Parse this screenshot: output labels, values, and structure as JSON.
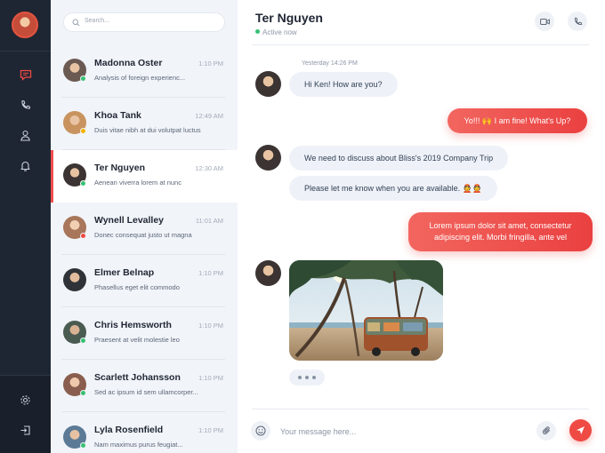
{
  "search": {
    "placeholder": "Search..."
  },
  "contacts": [
    {
      "name": "Madonna Oster",
      "time": "1:10 PM",
      "preview": "Analysis of foreign experienc...",
      "status": "online",
      "avatar_color": "#6b5a52"
    },
    {
      "name": "Khoa Tank",
      "time": "12:49 AM",
      "preview": "Duis vitae nibh at dui volutpat luctus",
      "status": "away",
      "avatar_color": "#c8935f"
    },
    {
      "name": "Ter  Nguyen",
      "time": "12:30 AM",
      "preview": "Aenean viverra lorem at nunc",
      "status": "online",
      "avatar_color": "#3b3432"
    },
    {
      "name": "Wynell Levalley",
      "time": "11:01 AM",
      "preview": "Donec consequat justo ut magna",
      "status": "busy",
      "avatar_color": "#a8765a"
    },
    {
      "name": "Elmer Belnap",
      "time": "1:10 PM",
      "preview": "Phasellus eget elit commodo",
      "status": "none",
      "avatar_color": "#2f3338"
    },
    {
      "name": "Chris Hemsworth",
      "time": "1:10 PM",
      "preview": "Praesent at velit molestie leo",
      "status": "online",
      "avatar_color": "#4a5b52"
    },
    {
      "name": "Scarlett Johansson",
      "time": "1:10 PM",
      "preview": "Sed ac ipsum id sem ullamcorper...",
      "status": "online",
      "avatar_color": "#8a5e4e"
    },
    {
      "name": "Lyla Rosenfield",
      "time": "1:10 PM",
      "preview": "Nam maximus purus feugiat...",
      "status": "online",
      "avatar_color": "#5c7a96"
    }
  ],
  "header": {
    "name": "Ter Nguyen",
    "status": "Active now"
  },
  "conversation": {
    "timestamp": "Yesterday 14:26 PM",
    "msg1": "Hi Ken! How are you?",
    "msg2": "Yo!!! 🙌 I am fine! What's Up?",
    "msg3": "We need to discuss about Bliss's 2019 Company Trip",
    "msg4": "Please let me know when you are available. 👲👲",
    "msg5_line1": "Lorem ipsum dolor sit amet, consectetur",
    "msg5_line2": "adipiscing elit. Morbi fringilla, ante vel"
  },
  "composer": {
    "placeholder": "Your message here..."
  },
  "colors": {
    "accent": "#ef4a44",
    "rail": "#1f2633",
    "online": "#38c172",
    "away": "#f4b400",
    "busy": "#ef4a44"
  }
}
